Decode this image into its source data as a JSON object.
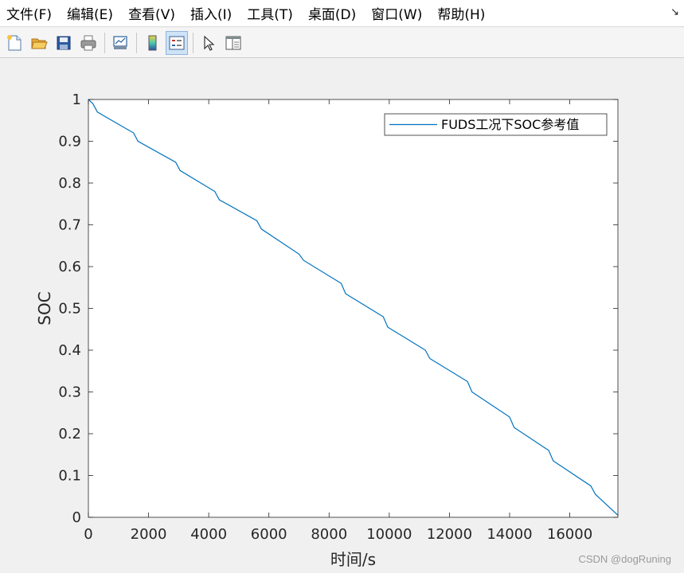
{
  "menu": {
    "items": [
      "文件(F)",
      "编辑(E)",
      "查看(V)",
      "插入(I)",
      "工具(T)",
      "桌面(D)",
      "窗口(W)",
      "帮助(H)"
    ]
  },
  "toolbar": {
    "icons": [
      "new-figure-icon",
      "open-file-icon",
      "save-icon",
      "print-icon",
      "link-plot-icon",
      "colorbar-icon",
      "legend-icon",
      "pointer-icon",
      "property-editor-icon"
    ]
  },
  "watermark": "CSDN @dogRuning",
  "chart_data": {
    "type": "line",
    "title": "",
    "xlabel": "时间/s",
    "ylabel": "SOC",
    "xlim": [
      0,
      17600
    ],
    "ylim": [
      0,
      1
    ],
    "xticks": [
      0,
      2000,
      4000,
      6000,
      8000,
      10000,
      12000,
      14000,
      16000
    ],
    "yticks": [
      0,
      0.1,
      0.2,
      0.3,
      0.4,
      0.5,
      0.6,
      0.7,
      0.8,
      0.9,
      1
    ],
    "grid": false,
    "legend": {
      "position": "top-right"
    },
    "series": [
      {
        "name": "FUDS工况下SOC参考值",
        "color": "#0072bd",
        "x": [
          0,
          150,
          300,
          1500,
          1650,
          2900,
          3050,
          4200,
          4350,
          5600,
          5750,
          7000,
          7150,
          8400,
          8550,
          9800,
          9950,
          11200,
          11350,
          12600,
          12750,
          14000,
          14150,
          15300,
          15450,
          16700,
          16850,
          17600
        ],
        "y": [
          1.0,
          0.99,
          0.97,
          0.92,
          0.9,
          0.85,
          0.83,
          0.78,
          0.76,
          0.71,
          0.69,
          0.63,
          0.615,
          0.56,
          0.535,
          0.48,
          0.455,
          0.4,
          0.38,
          0.325,
          0.3,
          0.24,
          0.215,
          0.16,
          0.135,
          0.075,
          0.055,
          0.005
        ]
      }
    ]
  }
}
